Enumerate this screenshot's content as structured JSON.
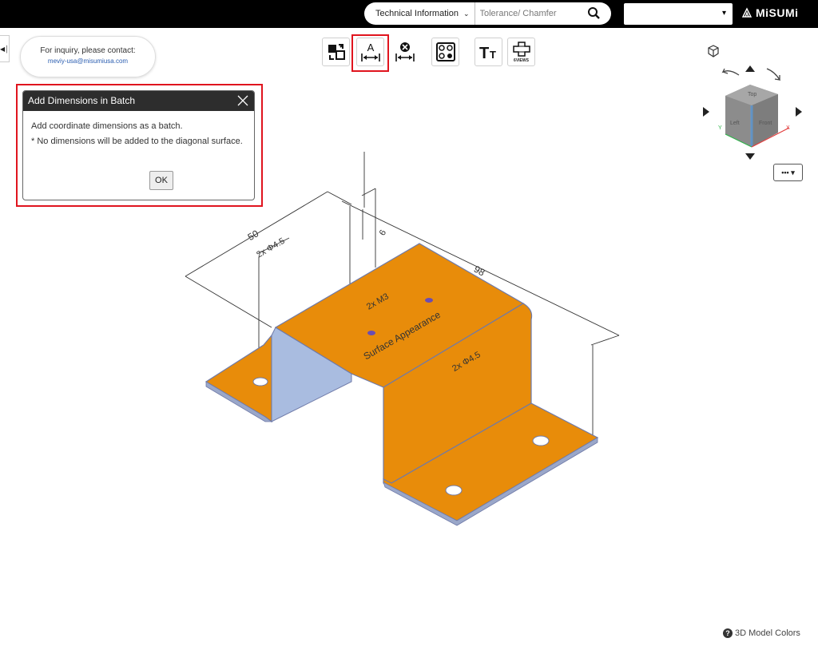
{
  "header": {
    "search_category": "Technical Information",
    "search_placeholder": "Tolerance/ Chamfer",
    "select_value": "",
    "logo_text": "MiSUMi"
  },
  "inquiry": {
    "line1": "For inquiry, please contact:",
    "email": "meviy-usa@misumiusa.com"
  },
  "toolbar": {
    "buttons": [
      {
        "name": "switch-view",
        "icon": "swap-icon"
      },
      {
        "name": "add-dimensions-batch",
        "icon": "dimension-a-icon",
        "highlighted": true
      },
      {
        "name": "delete-dimensions",
        "icon": "dimension-x-icon"
      },
      {
        "name": "hole-view",
        "icon": "holes-icon"
      },
      {
        "name": "text-size",
        "icon": "text-size-icon"
      },
      {
        "name": "six-views",
        "icon": "six-views-icon",
        "label": "6VIEWS"
      }
    ]
  },
  "dialog": {
    "title": "Add Dimensions in Batch",
    "line1": "Add coordinate dimensions as a batch.",
    "line2": "* No dimensions will be added to the diagonal surface.",
    "ok_label": "OK"
  },
  "viewcube": {
    "top": "Top",
    "left": "Left",
    "front": "Front",
    "axis_x": "X",
    "axis_y": "Y"
  },
  "more_button": "••• ▾",
  "model": {
    "dim_50": "50",
    "dim_98": "98",
    "dim_6": "6",
    "hole_note_1": "2x Φ4.5",
    "hole_note_2": "2x Φ4.5",
    "tap_note": "2x M3",
    "surface_note": "Surface Appearance",
    "part_color": "#e88c0a",
    "inner_color": "#a9bce0"
  },
  "footer": {
    "colors_link": "3D Model Colors"
  }
}
